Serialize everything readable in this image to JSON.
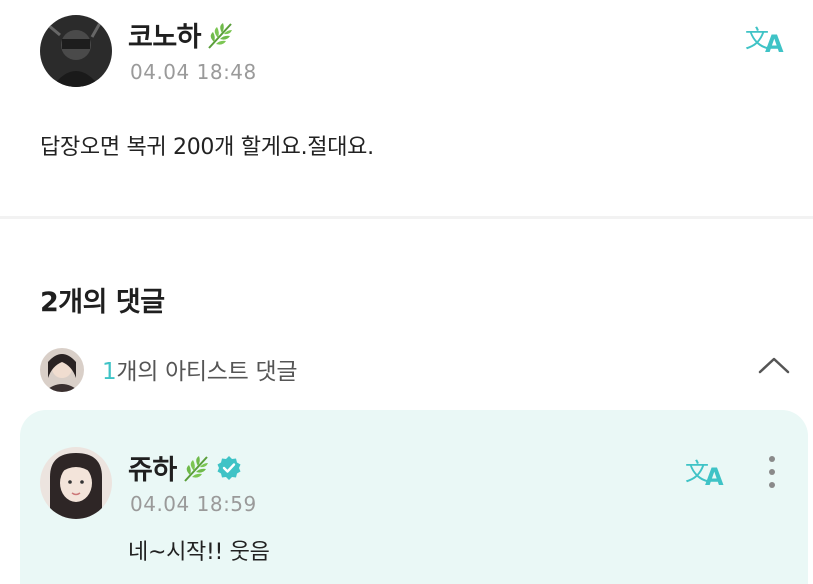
{
  "post": {
    "author": "코노하",
    "author_badge_icon": "leaf-icon",
    "timestamp": "04.04 18:48",
    "text": "답장오면 복귀 200개 할게요.절대요.",
    "translate_icon": "translate-icon"
  },
  "comments": {
    "count_label": "2개의 댓글",
    "artist_count": "1",
    "artist_label_suffix": "개의 아티스트 댓글",
    "toggle_icon": "chevron-up-icon"
  },
  "reply": {
    "author": "쥬하",
    "author_badge_icon": "leaf-icon",
    "verified_icon": "verified-check-icon",
    "timestamp": "04.04 18:59",
    "text": "네~시작!! 웃음",
    "translate_icon": "translate-icon",
    "more_icon": "more-vertical-icon"
  },
  "colors": {
    "accent": "#3fc3c6",
    "reply_background": "#eaf8f6",
    "timestamp": "#9a9a9a"
  }
}
